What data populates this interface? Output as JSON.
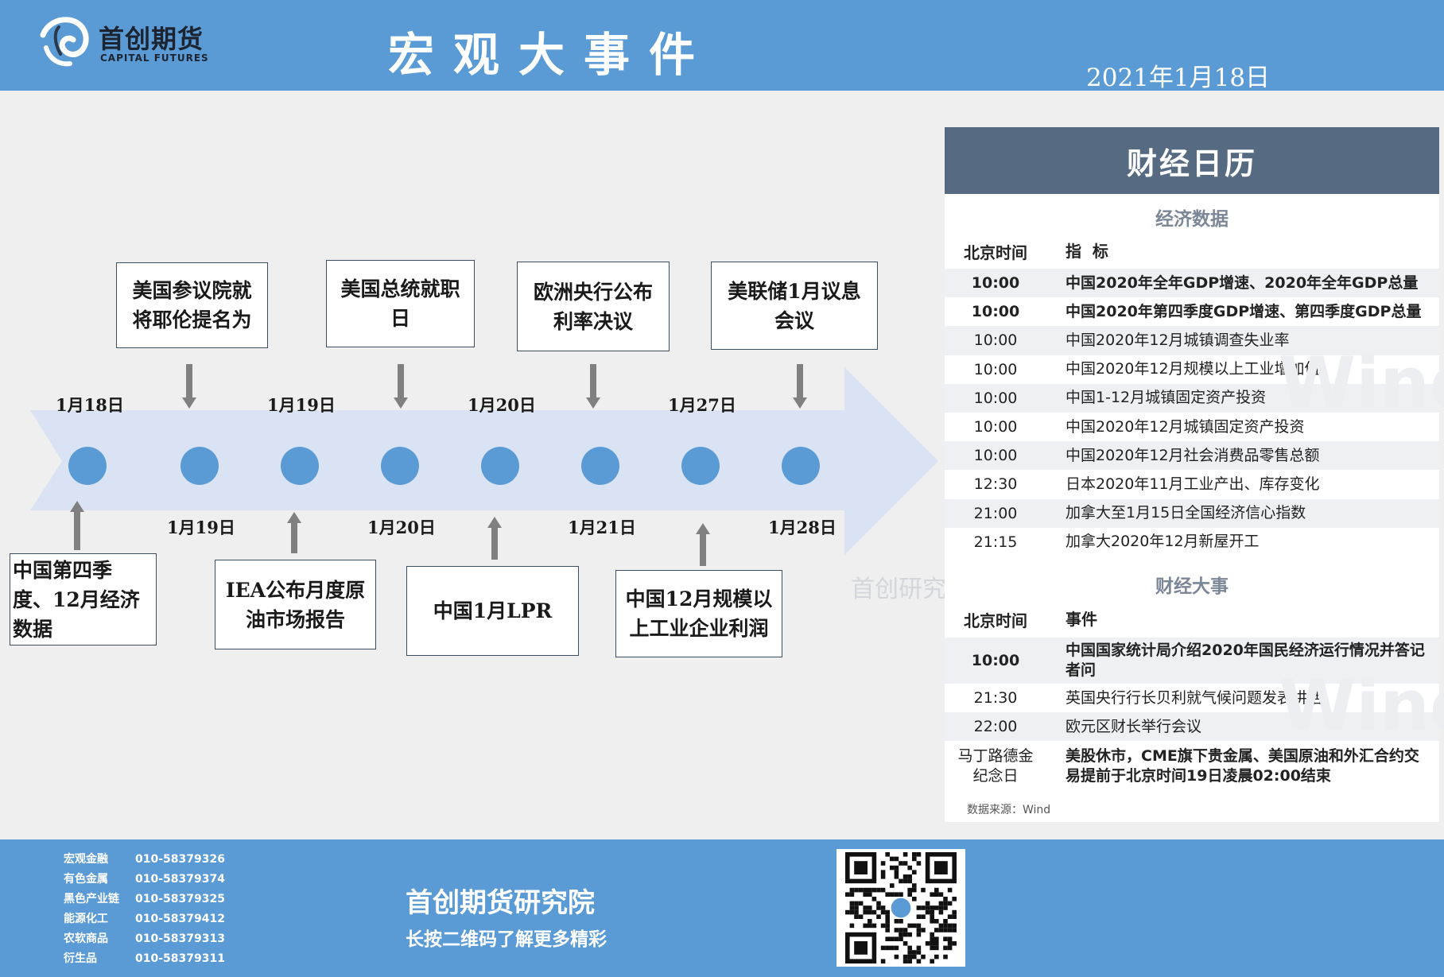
{
  "header": {
    "logo_cn": "首创期货",
    "logo_en": "CAPITAL FUTURES",
    "title": "宏观大事件",
    "date": "2021年1月18日"
  },
  "timeline": {
    "top_dates": [
      "1月18日",
      "1月19日",
      "1月20日",
      "1月27日"
    ],
    "bottom_dates": [
      "1月19日",
      "1月20日",
      "1月21日",
      "1月28日"
    ],
    "top_events": [
      "美国参议院就将耶伦提名为",
      "美国总统就职日",
      "欧洲央行公布利率决议",
      "美联储1月议息会议"
    ],
    "bottom_events": [
      "中国第四季度、12月经济数据",
      "IEA公布月度原油市场报告",
      "中国1月LPR",
      "中国12月规模以上工业企业利润"
    ],
    "watermark": "首创研究"
  },
  "calendar": {
    "title": "财经日历",
    "econ_section": "经济数据",
    "econ_head": {
      "time": "北京时间",
      "name": "指  标"
    },
    "econ_rows": [
      {
        "time": "10:00",
        "name": "中国2020年全年GDP增速、2020年全年GDP总量",
        "bold": true
      },
      {
        "time": "10:00",
        "name": "中国2020年第四季度GDP增速、第四季度GDP总量",
        "bold": true
      },
      {
        "time": "10:00",
        "name": "中国2020年12月城镇调查失业率",
        "bold": false
      },
      {
        "time": "10:00",
        "name": "中国2020年12月规模以上工业增加值",
        "bold": false
      },
      {
        "time": "10:00",
        "name": "中国1-12月城镇固定资产投资",
        "bold": false
      },
      {
        "time": "10:00",
        "name": "中国2020年12月城镇固定资产投资",
        "bold": false
      },
      {
        "time": "10:00",
        "name": "中国2020年12月社会消费品零售总额",
        "bold": false
      },
      {
        "time": "12:30",
        "name": "日本2020年11月工业产出、库存变化",
        "bold": false
      },
      {
        "time": "21:00",
        "name": "加拿大至1月15日全国经济信心指数",
        "bold": false
      },
      {
        "time": "21:15",
        "name": "加拿大2020年12月新屋开工",
        "bold": false
      }
    ],
    "event_section": "财经大事",
    "event_head": {
      "time": "北京时间",
      "name": "事件"
    },
    "event_rows": [
      {
        "time": "10:00",
        "name": "中国国家统计局介绍2020年国民经济运行情况并答记者问",
        "bold": true
      },
      {
        "time": "21:30",
        "name": "英国央行行长贝利就气候问题发表讲话",
        "bold": false
      },
      {
        "time": "22:00",
        "name": "欧元区财长举行会议",
        "bold": false
      },
      {
        "time": "马丁路德金纪念日",
        "name": "美股休市，CME旗下贵金属、美国原油和外汇合约交易提前于北京时间19日凌晨02:00结束",
        "bold": true
      }
    ],
    "source": "数据来源：Wind",
    "watermark": "Wind"
  },
  "footer": {
    "contacts": [
      {
        "dept": "宏观金融",
        "phone": "010-58379326"
      },
      {
        "dept": "有色金属",
        "phone": "010-58379374"
      },
      {
        "dept": "黑色产业链",
        "phone": "010-58379325"
      },
      {
        "dept": "能源化工",
        "phone": "010-58379412"
      },
      {
        "dept": "农软商品",
        "phone": "010-58379313"
      },
      {
        "dept": "衍生品",
        "phone": "010-58379311"
      }
    ],
    "org": "首创期货研究院",
    "tagline": "长按二维码了解更多精彩"
  },
  "colors": {
    "header_bg": "#5b9bd5",
    "calendar_header": "#566b82",
    "arrow": "#dae3f3",
    "dot": "#5b9bd5",
    "gray_arrow": "#808080"
  }
}
